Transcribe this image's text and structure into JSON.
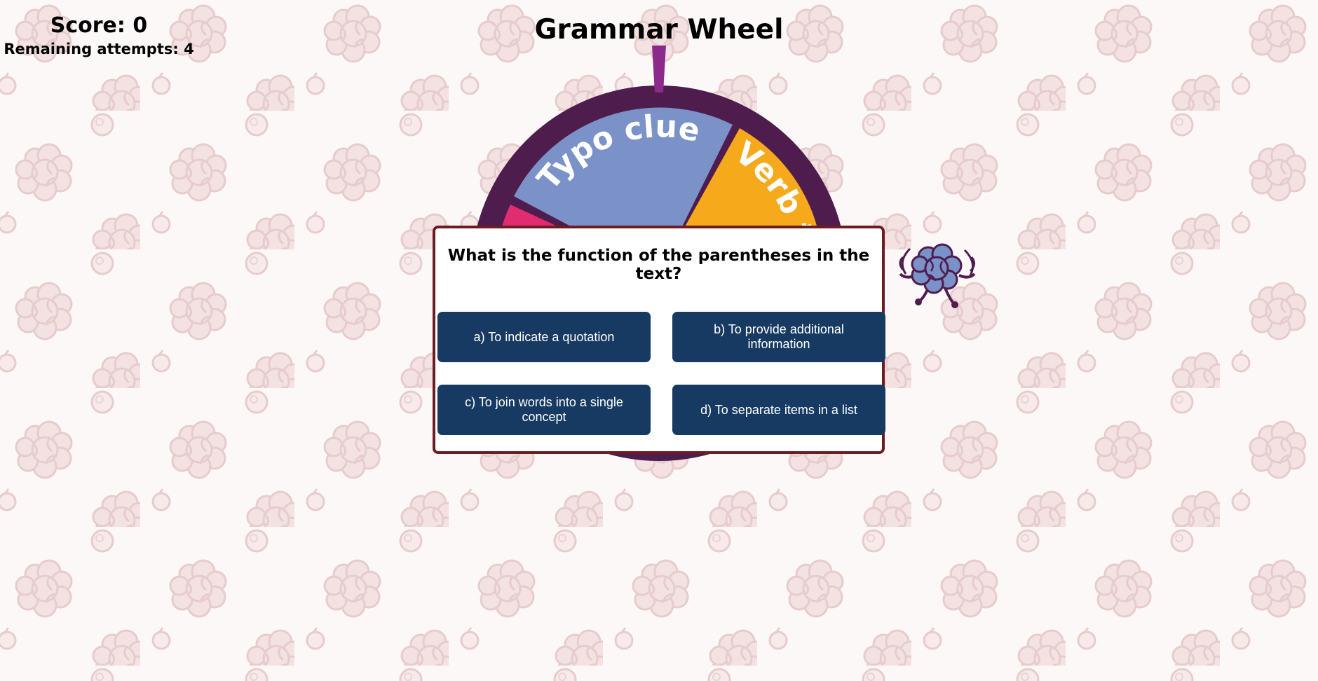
{
  "hud": {
    "score": "Score: 0",
    "attempts": "Remaining attempts: 4"
  },
  "title": "Grammar Wheel",
  "wheel": {
    "segments": [
      {
        "label": "Typo clues",
        "color": "#7b92c8"
      },
      {
        "label": "Verb tenses",
        "color": "#f6a91a"
      },
      {
        "label": "",
        "color": "#e12c71"
      }
    ],
    "rim_color": "#4e1d4e",
    "pointer_color": "#8b2a8b"
  },
  "question": {
    "text": "What is the function of the parentheses in the text?",
    "answers": [
      "a) To indicate a quotation",
      "b) To provide additional information",
      "c) To join words into a single concept",
      "d) To separate items in a list"
    ]
  },
  "colors": {
    "answer_bg": "#163a62",
    "dialog_border": "#6b1d22",
    "pattern": "#e8cfcf"
  }
}
